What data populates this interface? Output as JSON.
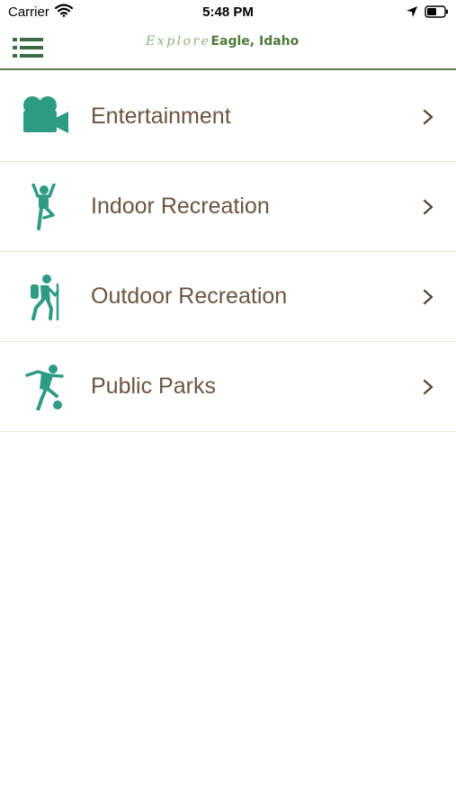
{
  "status_bar": {
    "carrier": "Carrier",
    "time": "5:48 PM"
  },
  "header": {
    "brand_script": "Explore",
    "brand_main": "Eagle, Idaho"
  },
  "colors": {
    "accent": "#2e9b84",
    "brand_green": "#4f7a3b",
    "label": "#6b5440",
    "chevron": "#5a4a3a",
    "divider": "#e6e7d6"
  },
  "categories": [
    {
      "label": "Entertainment",
      "icon": "video-camera-icon"
    },
    {
      "label": "Indoor Recreation",
      "icon": "yoga-pose-icon"
    },
    {
      "label": "Outdoor Recreation",
      "icon": "hiker-icon"
    },
    {
      "label": "Public Parks",
      "icon": "soccer-player-icon"
    }
  ]
}
